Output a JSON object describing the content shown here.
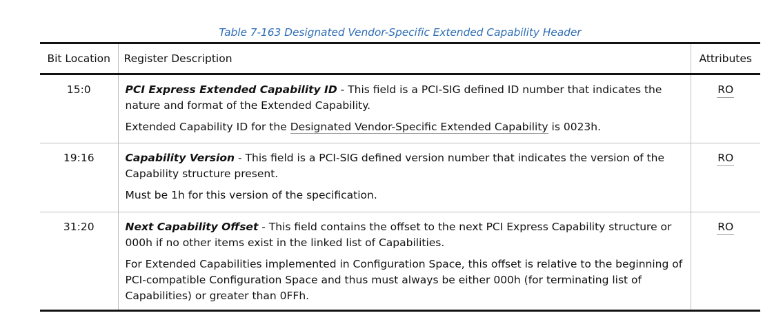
{
  "caption": "Table  7-163  Designated Vendor-Specific Extended Capability Header",
  "headers": {
    "bit": "Bit Location",
    "desc": "Register Description",
    "attr": "Attributes"
  },
  "rows": [
    {
      "bit": "15:0",
      "field_name": "PCI Express Extended Capability ID",
      "field_desc": " - This field is a PCI-SIG defined ID number that indicates the nature and format of the Extended Capability.",
      "note_pre": "Extended Capability ID for the ",
      "note_link": "Designated Vendor-Specific Extended Capability",
      "note_post": " is 0023h.",
      "attr": "RO"
    },
    {
      "bit": "19:16",
      "field_name": "Capability Version",
      "field_desc": " - This field is a PCI-SIG defined version number that indicates the version of the Capability structure present.",
      "note": "Must be 1h for this version of the specification.",
      "attr": "RO"
    },
    {
      "bit": "31:20",
      "field_name": "Next Capability Offset",
      "field_desc": " - This field contains the offset to the next PCI Express Capability structure or 000h if no other items exist in the linked list of Capabilities.",
      "note": "For Extended Capabilities implemented in Configuration Space, this offset is relative to the beginning of PCI-compatible Configuration Space and thus must always be either 000h (for terminating list of Capabilities) or greater than 0FFh.",
      "attr": "RO"
    }
  ],
  "colors": {
    "caption": "#2f6eb5",
    "rule_heavy": "#111111",
    "rule_light": "#bdbdbd"
  }
}
